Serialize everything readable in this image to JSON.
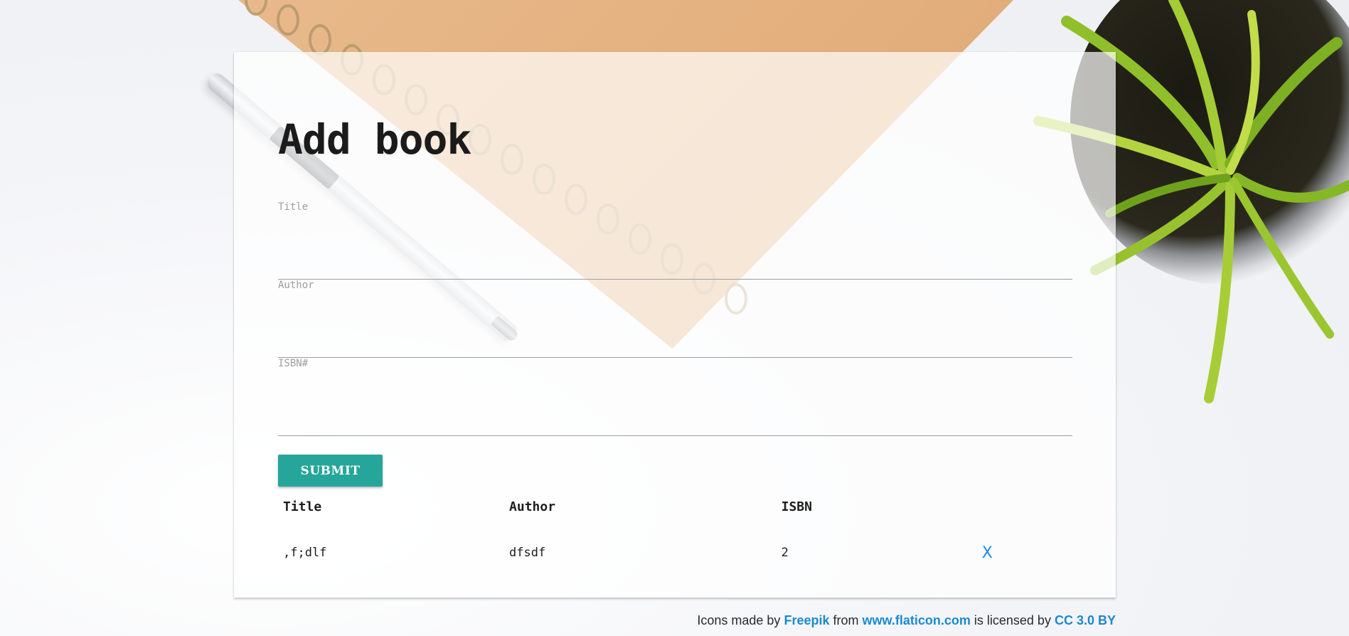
{
  "form": {
    "title": "Add book",
    "fields": [
      {
        "label": "Title",
        "value": ""
      },
      {
        "label": "Author",
        "value": ""
      },
      {
        "label": "ISBN#",
        "value": ""
      }
    ],
    "submit_label": "SUBMIT"
  },
  "table": {
    "headers": [
      "Title",
      "Author",
      "ISBN",
      ""
    ],
    "rows": [
      {
        "title": ",f;dlf",
        "author": "dfsdf",
        "isbn": "2",
        "delete_label": "X"
      }
    ]
  },
  "footer": {
    "text_1": "Icons made by",
    "link_1": "Freepik",
    "text_2": "from",
    "link_2": "www.flaticon.com",
    "text_3": "is licensed by",
    "link_3": "CC 3.0 BY"
  },
  "colors": {
    "submit_bg": "#26a69a",
    "link": "#1e88e5"
  }
}
